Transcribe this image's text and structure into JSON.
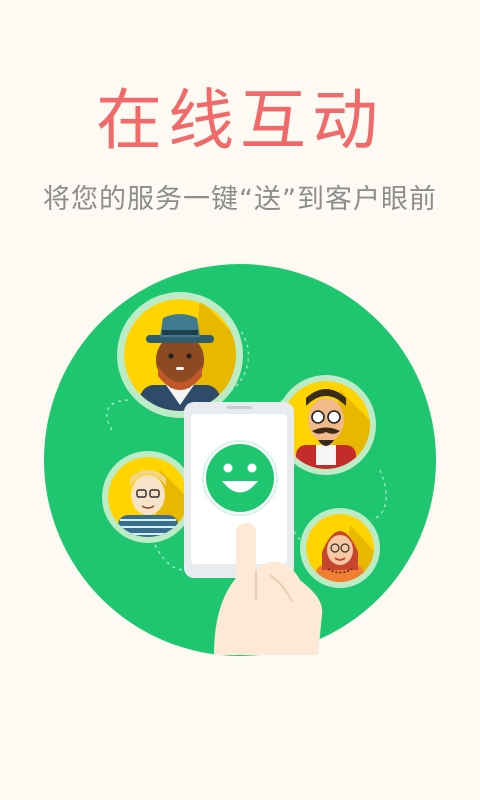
{
  "splash": {
    "title": "在线互动",
    "subtitle": "将您的服务一键“送”到客户眼前"
  },
  "colors": {
    "background": "#fdfaf4",
    "title": "#f06a6a",
    "subtitle": "#8d8d8d",
    "circle": "#1ec76f",
    "avatar_ring": "#bdebc8",
    "avatar_bg": "#ffd400",
    "smiley": "#1ec76f"
  },
  "icons": {
    "phone": "smartphone-icon",
    "smiley": "smiley-face-icon",
    "hand": "hand-icon"
  }
}
